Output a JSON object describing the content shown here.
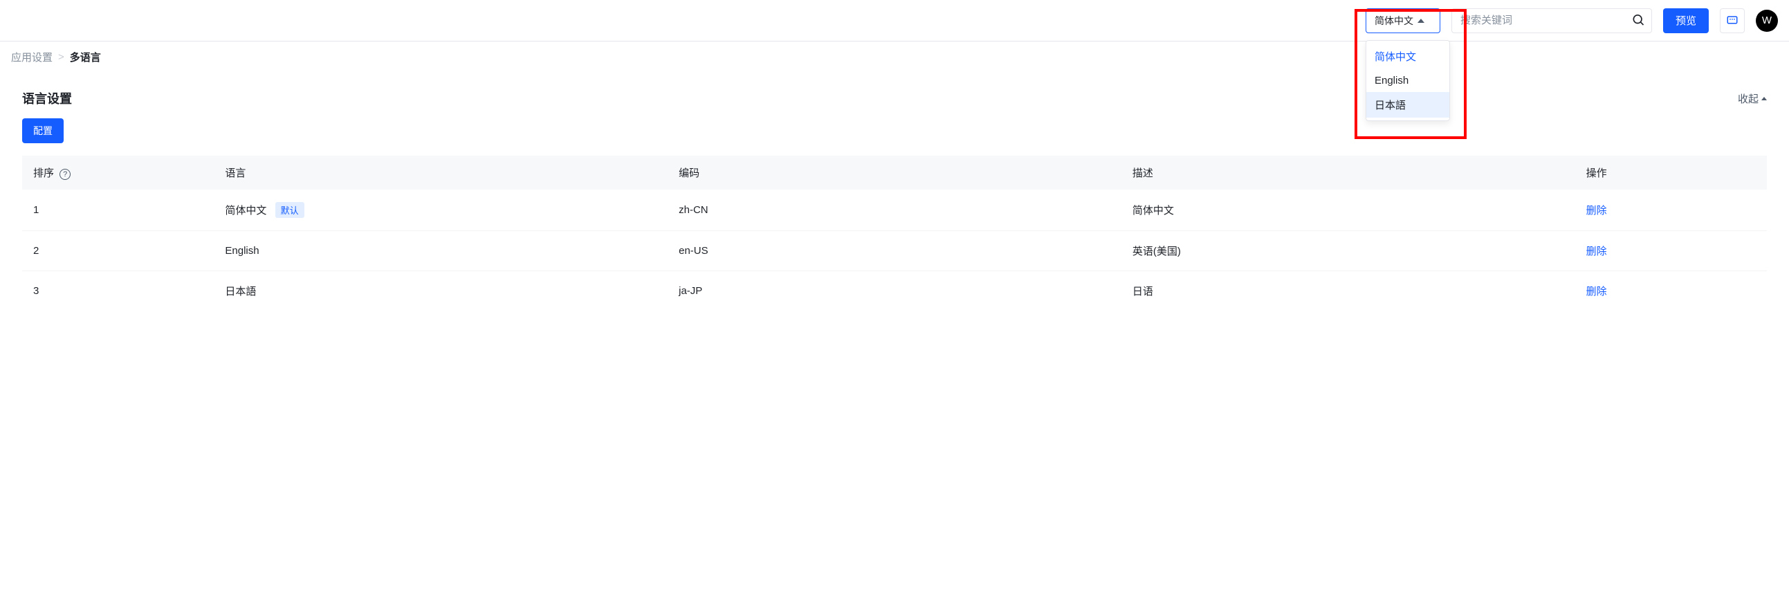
{
  "topbar": {
    "language_select": {
      "current": "简体中文",
      "options": [
        {
          "label": "简体中文",
          "active": true,
          "hover": false
        },
        {
          "label": "English",
          "active": false,
          "hover": false
        },
        {
          "label": "日本語",
          "active": false,
          "hover": true
        }
      ]
    },
    "search_placeholder": "搜索关键词",
    "preview_label": "预览",
    "avatar_initial": "W"
  },
  "breadcrumb": {
    "parent": "应用设置",
    "separator": ">",
    "current": "多语言"
  },
  "section": {
    "title": "语言设置",
    "collapse_label": "收起",
    "configure_label": "配置"
  },
  "table": {
    "headers": {
      "order": "排序",
      "language": "语言",
      "code": "编码",
      "description": "描述",
      "action": "操作"
    },
    "default_tag": "默认",
    "delete_label": "删除",
    "rows": [
      {
        "order": "1",
        "language": "简体中文",
        "is_default": true,
        "code": "zh-CN",
        "description": "简体中文"
      },
      {
        "order": "2",
        "language": "English",
        "is_default": false,
        "code": "en-US",
        "description": "英语(美国)"
      },
      {
        "order": "3",
        "language": "日本語",
        "is_default": false,
        "code": "ja-JP",
        "description": "日语"
      }
    ]
  }
}
